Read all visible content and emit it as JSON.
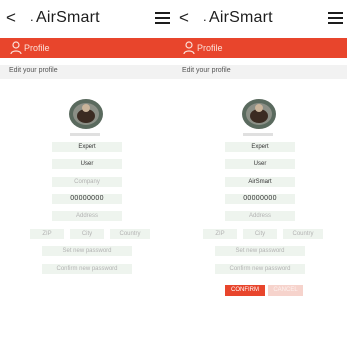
{
  "app": {
    "logo": "AirSmart",
    "back_glyph": "<"
  },
  "profile_bar": {
    "label": "Profile"
  },
  "edit": {
    "title": "Edit your profile"
  },
  "left": {
    "first_name": "Expert",
    "last_name": "User",
    "company_placeholder": "Company",
    "phone": "00000000",
    "address_placeholder": "Address",
    "zip_placeholder": "ZIP",
    "city_placeholder": "City",
    "country_placeholder": "Country",
    "new_password_placeholder": "Set new password",
    "confirm_password_placeholder": "Confirm new password"
  },
  "right": {
    "first_name": "Expert",
    "last_name": "User",
    "company": "AirSmart",
    "phone": "00000000",
    "address_placeholder": "Address",
    "zip_placeholder": "ZIP",
    "city_placeholder": "City",
    "country_placeholder": "Country",
    "new_password_placeholder": "Set new password",
    "confirm_password_placeholder": "Confirm new password",
    "confirm_button": "CONFIRM",
    "cancel_button": "CANCEL"
  },
  "colors": {
    "accent": "#e8452c",
    "field_bg": "#eef4ee",
    "cancel_bg": "#f6d3cc"
  },
  "icons": [
    "back-icon",
    "menu-icon",
    "profile-icon",
    "avatar-icon"
  ]
}
